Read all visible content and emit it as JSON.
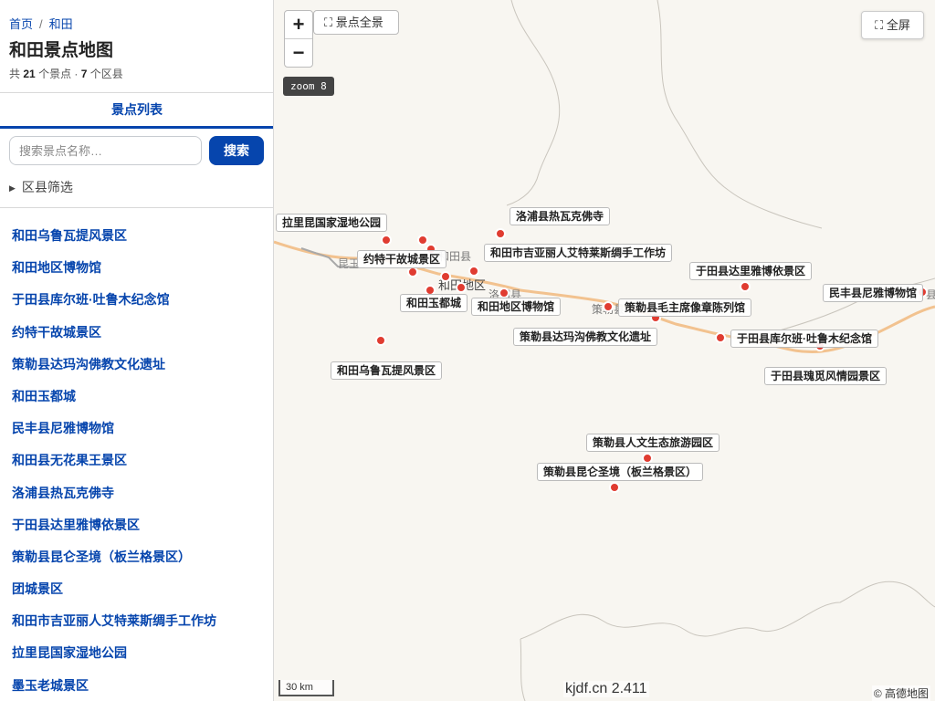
{
  "breadcrumb": {
    "home": "首页",
    "separator": "/",
    "current": "和田"
  },
  "page_title": "和田景点地图",
  "stats": {
    "prefix": "共",
    "spots_count": "21",
    "spots_unit": "个景点 ·",
    "counties_count": "7",
    "counties_unit": "个区县"
  },
  "tab": {
    "label": "景点列表"
  },
  "search": {
    "placeholder": "搜索景点名称…",
    "button_label": "搜索"
  },
  "filter": {
    "arrow": "▶",
    "label": "区县筛选"
  },
  "spots": [
    "和田乌鲁瓦提风景区",
    "和田地区博物馆",
    "于田县库尔班·吐鲁木纪念馆",
    "约特干故城景区",
    "策勒县达玛沟佛教文化遗址",
    "和田玉都城",
    "民丰县尼雅博物馆",
    "和田县无花果王景区",
    "洛浦县热瓦克佛寺",
    "于田县达里雅博依景区",
    "策勒县昆仑圣境（板兰格景区）",
    "团城景区",
    "和田市吉亚丽人艾特莱斯绸手工作坊",
    "拉里昆国家湿地公园",
    "墨玉老城景区"
  ],
  "map": {
    "zoom_in": "+",
    "zoom_out": "−",
    "overview_icon": "⛶",
    "overview_label": "景点全景",
    "zoom_level": "zoom 8",
    "fullscreen_icon": "⛶",
    "fullscreen_label": "全屏",
    "place_names": {
      "kunyu": "昆玉",
      "hotan_county": "和田县",
      "hotan_district": "和田地区",
      "luopu": "洛浦县",
      "cele": "策勒县",
      "minfeng_edge": "县"
    },
    "poi_labels": {
      "lalikun": "拉里昆国家湿地公园",
      "luopu_rawak": "洛浦县热瓦克佛寺",
      "yaoteigan": "约特干故城景区",
      "jiyali": "和田市吉亚丽人艾特莱斯绸手工作坊",
      "yudoucheng": "和田玉都城",
      "museum": "和田地区博物馆",
      "mao": "策勒县毛主席像章陈列馆",
      "daliyaboyi": "于田县达里雅博依景区",
      "niya": "民丰县尼雅博物馆",
      "damagou": "策勒县达玛沟佛教文化遗址",
      "kurban": "于田县库尔班·吐鲁木纪念馆",
      "wuluwati": "和田乌鲁瓦提风景区",
      "rose": "于田县瑰觅风情园景区",
      "renwen": "策勒县人文生态旅游园区",
      "kunlun": "策勒县昆仑圣境（板兰格景区）"
    },
    "scale_label": "30 km",
    "version": "kjdf.cn 2.411",
    "attribution": "© 高德地图",
    "marker_color": "#e03c31"
  }
}
